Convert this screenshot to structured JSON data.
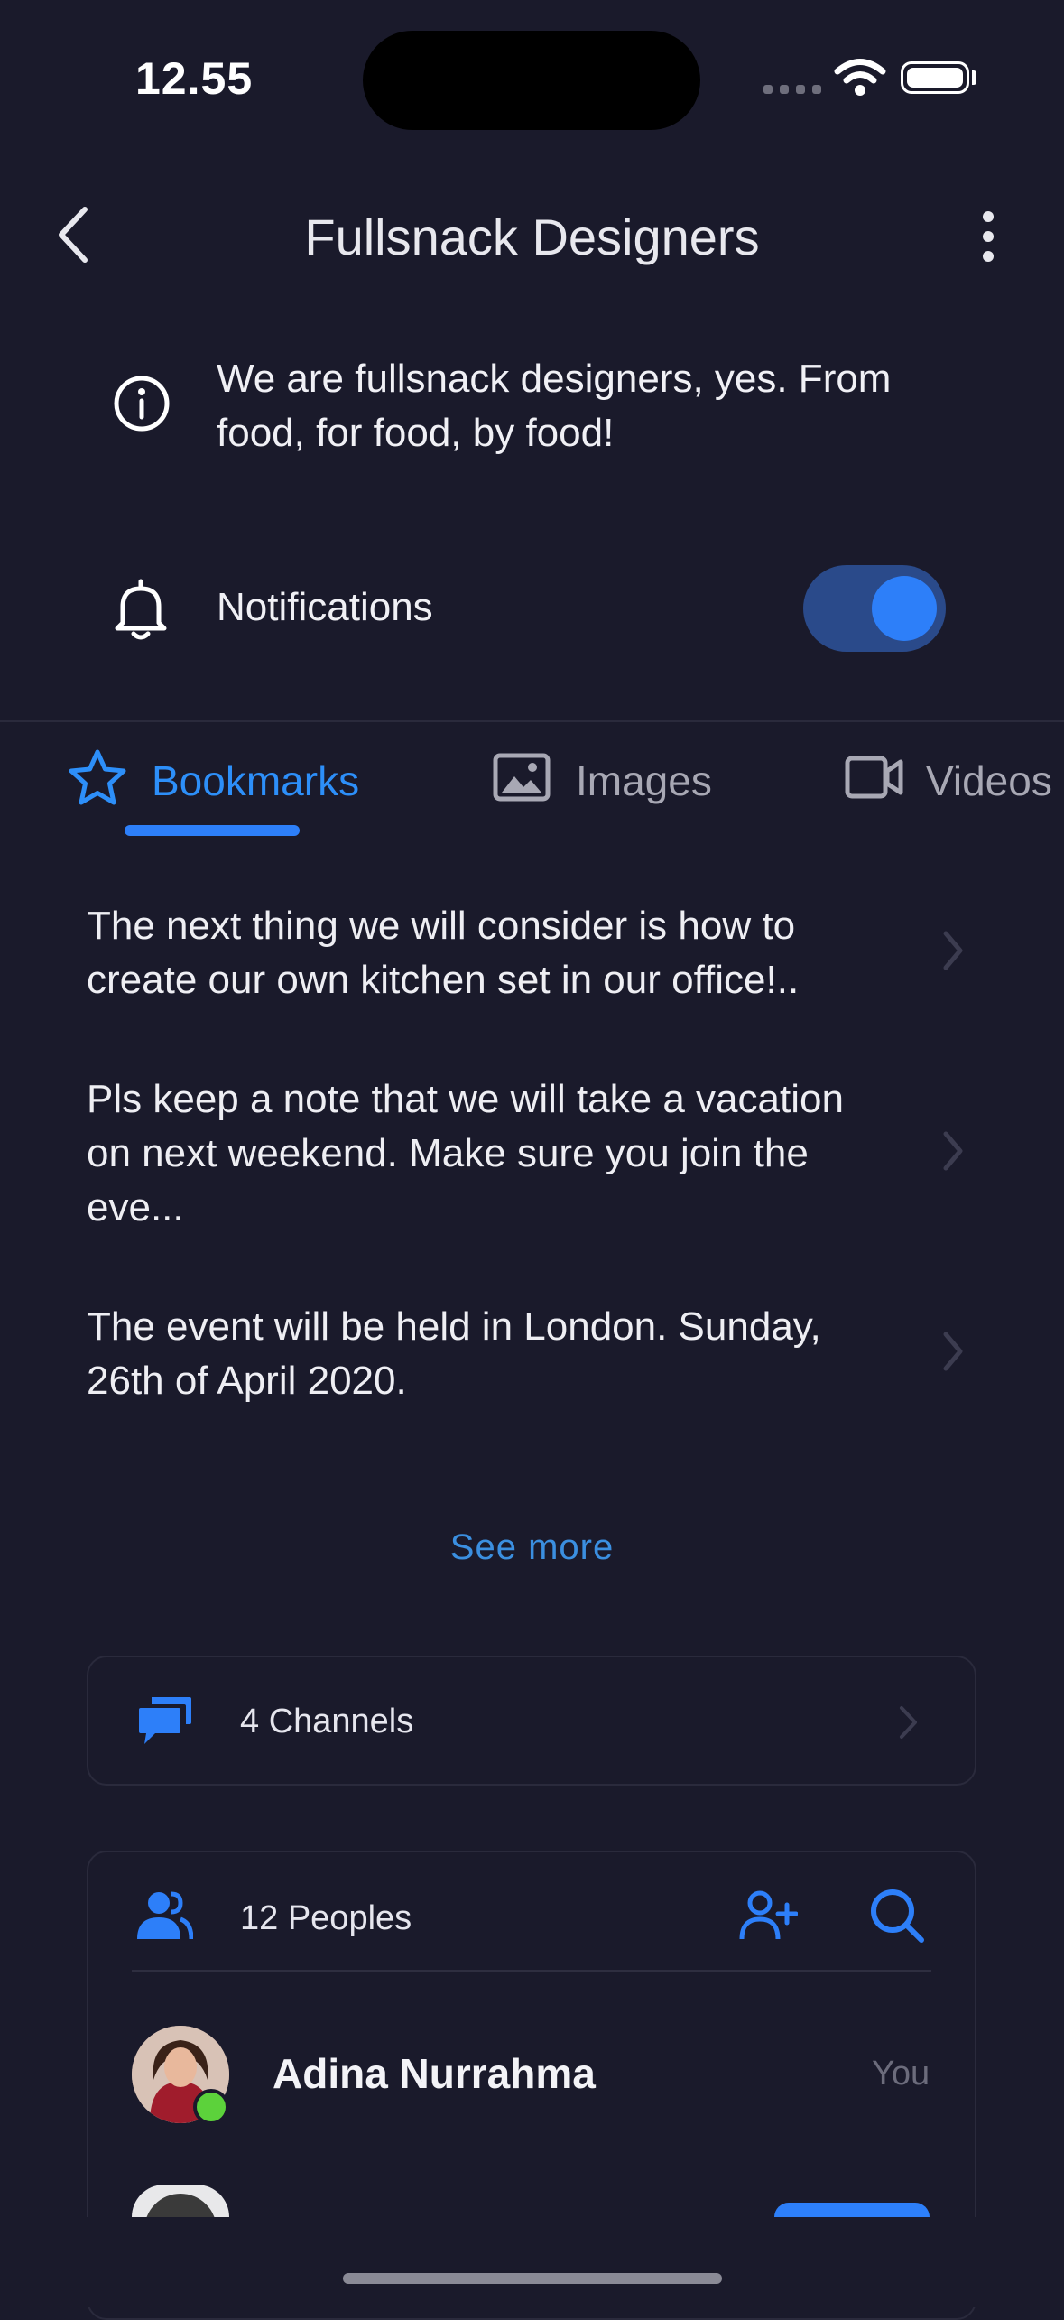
{
  "status": {
    "time": "12.55"
  },
  "header": {
    "title": "Fullsnack Designers"
  },
  "info": {
    "description": "We are fullsnack designers, yes. From food, for food, by food!"
  },
  "notifications": {
    "label": "Notifications",
    "enabled": true
  },
  "tabs": [
    {
      "label": "Bookmarks",
      "icon": "star-icon",
      "active": true
    },
    {
      "label": "Images",
      "icon": "image-icon",
      "active": false
    },
    {
      "label": "Videos",
      "icon": "video-icon",
      "active": false
    }
  ],
  "bookmarks": [
    {
      "text": "The next thing we will consider is how to create our own kitchen set in our office!.."
    },
    {
      "text": "Pls keep a note that we will take a vacation on next weekend. Make sure you join the eve..."
    },
    {
      "text": "The event will be held in London. Sunday, 26th of April 2020."
    }
  ],
  "see_more": "See more",
  "channels": {
    "label": "4 Channels"
  },
  "people": {
    "label": "12 Peoples",
    "members": [
      {
        "name": "Adina Nurrahma",
        "tag": "You",
        "online": true
      }
    ]
  },
  "colors": {
    "background": "#1a1a2b",
    "accent": "#2d7ff9",
    "online": "#5cd23b"
  }
}
